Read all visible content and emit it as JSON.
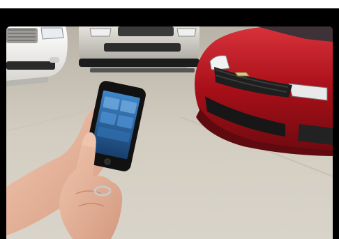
{
  "image": {
    "alt": "",
    "colors": {
      "frame": "#000000",
      "top_bar": "#ffffff",
      "pavement": "#cfc8bb",
      "red_car": "#b3121b",
      "white_car": "#f2f0ec",
      "silver_car": "#c9c7c0",
      "phone_screen": "#2b6db0",
      "skin": "#e8b9a0"
    }
  }
}
